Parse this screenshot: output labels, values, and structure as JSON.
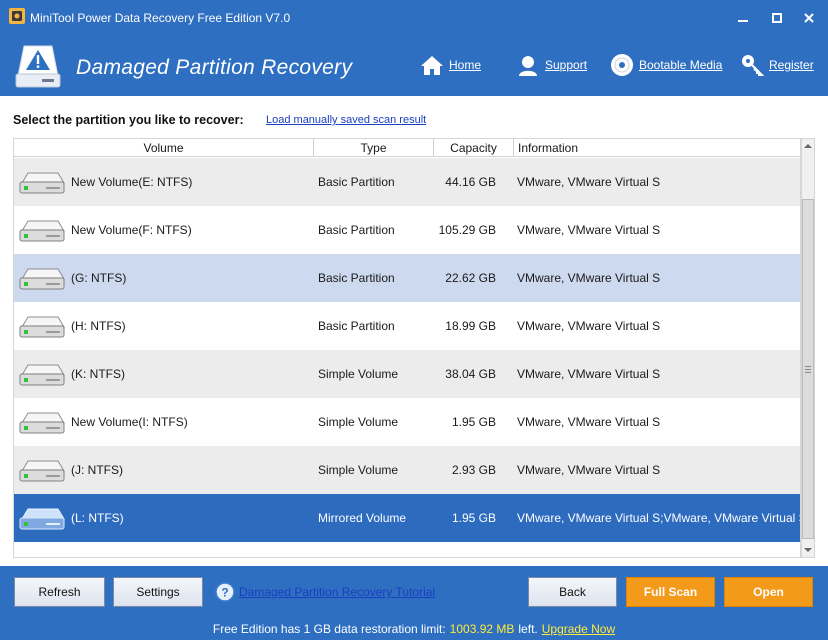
{
  "window": {
    "title": "MiniTool Power Data Recovery Free Edition V7.0",
    "minimize": "▁",
    "maximize": "□",
    "close": "✕"
  },
  "header": {
    "title": "Damaged Partition Recovery",
    "nav": [
      {
        "label": "Home",
        "icon": "home-icon"
      },
      {
        "label": "Support",
        "icon": "support-icon"
      },
      {
        "label": "Bootable Media",
        "icon": "disc-icon"
      },
      {
        "label": "Register",
        "icon": "key-icon"
      }
    ]
  },
  "main": {
    "select_label": "Select the partition you like to recover:",
    "load_link": "Load manually saved scan result",
    "columns": [
      "Volume",
      "Type",
      "Capacity",
      "Information"
    ],
    "rows": [
      {
        "volume": "New Volume(E: NTFS)",
        "type": "Basic Partition",
        "capacity": "44.16 GB",
        "info": "VMware, VMware Virtual S"
      },
      {
        "volume": "New Volume(F: NTFS)",
        "type": "Basic Partition",
        "capacity": "105.29 GB",
        "info": "VMware, VMware Virtual S"
      },
      {
        "volume": "(G: NTFS)",
        "type": "Basic Partition",
        "capacity": "22.62 GB",
        "info": "VMware, VMware Virtual S"
      },
      {
        "volume": "(H: NTFS)",
        "type": "Basic Partition",
        "capacity": "18.99 GB",
        "info": "VMware, VMware Virtual S"
      },
      {
        "volume": "(K: NTFS)",
        "type": "Simple Volume",
        "capacity": "38.04 GB",
        "info": "VMware, VMware Virtual S"
      },
      {
        "volume": "New Volume(I: NTFS)",
        "type": "Simple Volume",
        "capacity": "1.95 GB",
        "info": "VMware, VMware Virtual S"
      },
      {
        "volume": "(J: NTFS)",
        "type": "Simple Volume",
        "capacity": "2.93 GB",
        "info": "VMware, VMware Virtual S"
      },
      {
        "volume": "(L: NTFS)",
        "type": "Mirrored Volume",
        "capacity": "1.95 GB",
        "info": "VMware, VMware Virtual S;VMware, VMware Virtual S"
      }
    ]
  },
  "footer": {
    "refresh": "Refresh",
    "settings": "Settings",
    "tutorial": "Damaged Partition Recovery Tutorial",
    "back": "Back",
    "full_scan": "Full Scan",
    "open": "Open"
  },
  "status": {
    "prefix": "Free Edition has 1 GB data restoration limit:",
    "remaining": "1003.92 MB",
    "suffix": "left.",
    "upgrade": "Upgrade Now"
  },
  "colors": {
    "brand_blue": "#2f6fc2",
    "selected_row": "#2d6bbf",
    "accent_orange": "#f49a1a",
    "status_highlight": "#ffea3a"
  }
}
